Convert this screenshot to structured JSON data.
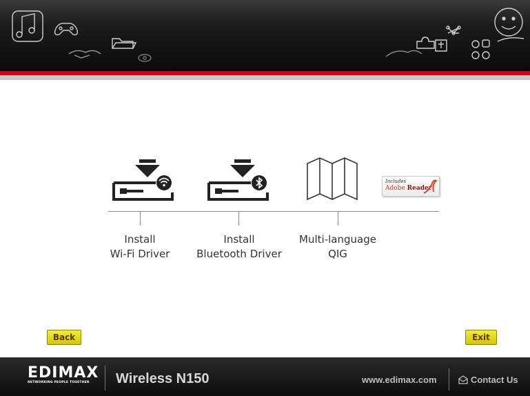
{
  "app": {
    "product_name": "Wireless N150",
    "brand_tagline": "NETWORKING PEOPLE TOGETHER",
    "brand_name": "EDIMAX"
  },
  "options": [
    {
      "label_line1": "Install",
      "label_line2": "Wi-Fi Driver",
      "icon": "download-wifi-icon"
    },
    {
      "label_line1": "Install",
      "label_line2": "Bluetooth Driver",
      "icon": "download-bluetooth-icon"
    },
    {
      "label_line1": "Multi-language",
      "label_line2": "QIG",
      "icon": "folded-map-icon"
    }
  ],
  "adobe_badge": {
    "line1": "Includes",
    "line2a": "Adobe",
    "line2b": "Reader"
  },
  "buttons": {
    "back_label": "Back",
    "exit_label": "Exit"
  },
  "footer": {
    "website": "www.edimax.com",
    "contact_label": "Contact Us"
  },
  "colors": {
    "accent_red": "#d6001c",
    "button_yellow": "#e6dc1a",
    "footer_bg": "#141414"
  }
}
